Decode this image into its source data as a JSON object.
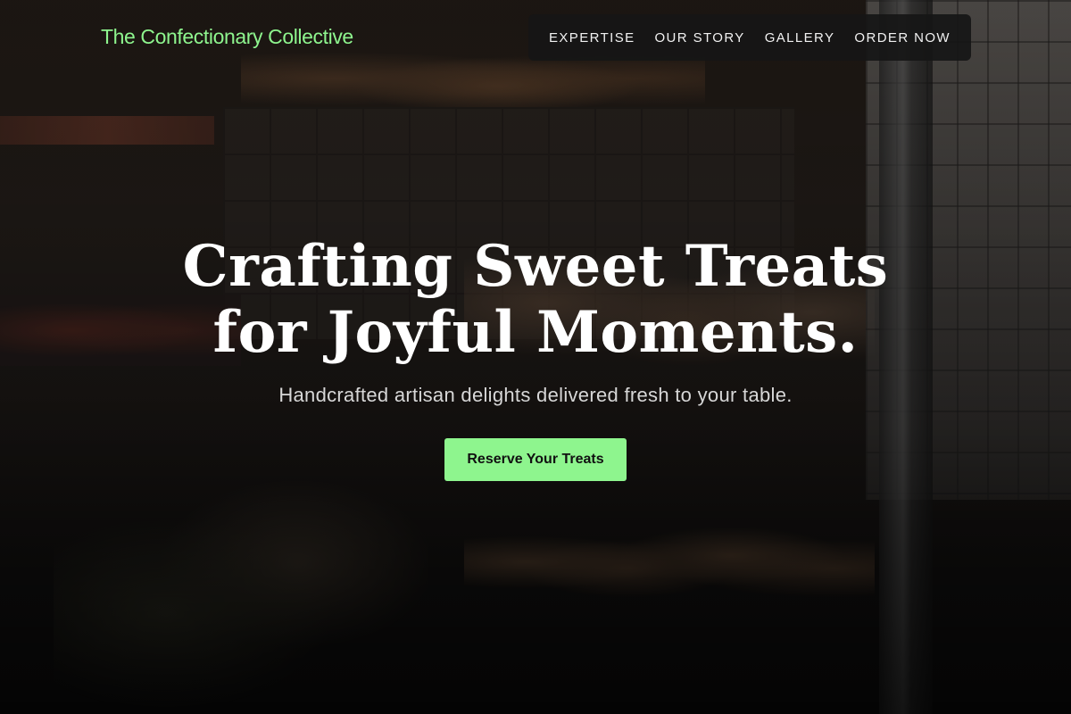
{
  "header": {
    "brand": "The Confectionary Collective",
    "nav": [
      {
        "label": "EXPERTISE"
      },
      {
        "label": "OUR STORY"
      },
      {
        "label": "GALLERY"
      },
      {
        "label": "ORDER NOW"
      }
    ]
  },
  "hero": {
    "title_line_1": "Crafting Sweet Treats",
    "title_line_2": "for Joyful Moments.",
    "subtitle": "Handcrafted artisan delights delivered fresh to your table.",
    "cta_label": "Reserve Your Treats"
  },
  "colors": {
    "accent": "#8ef58e",
    "nav_background": "#161616",
    "text_primary": "#ffffff",
    "text_secondary": "#d7d7d7"
  }
}
